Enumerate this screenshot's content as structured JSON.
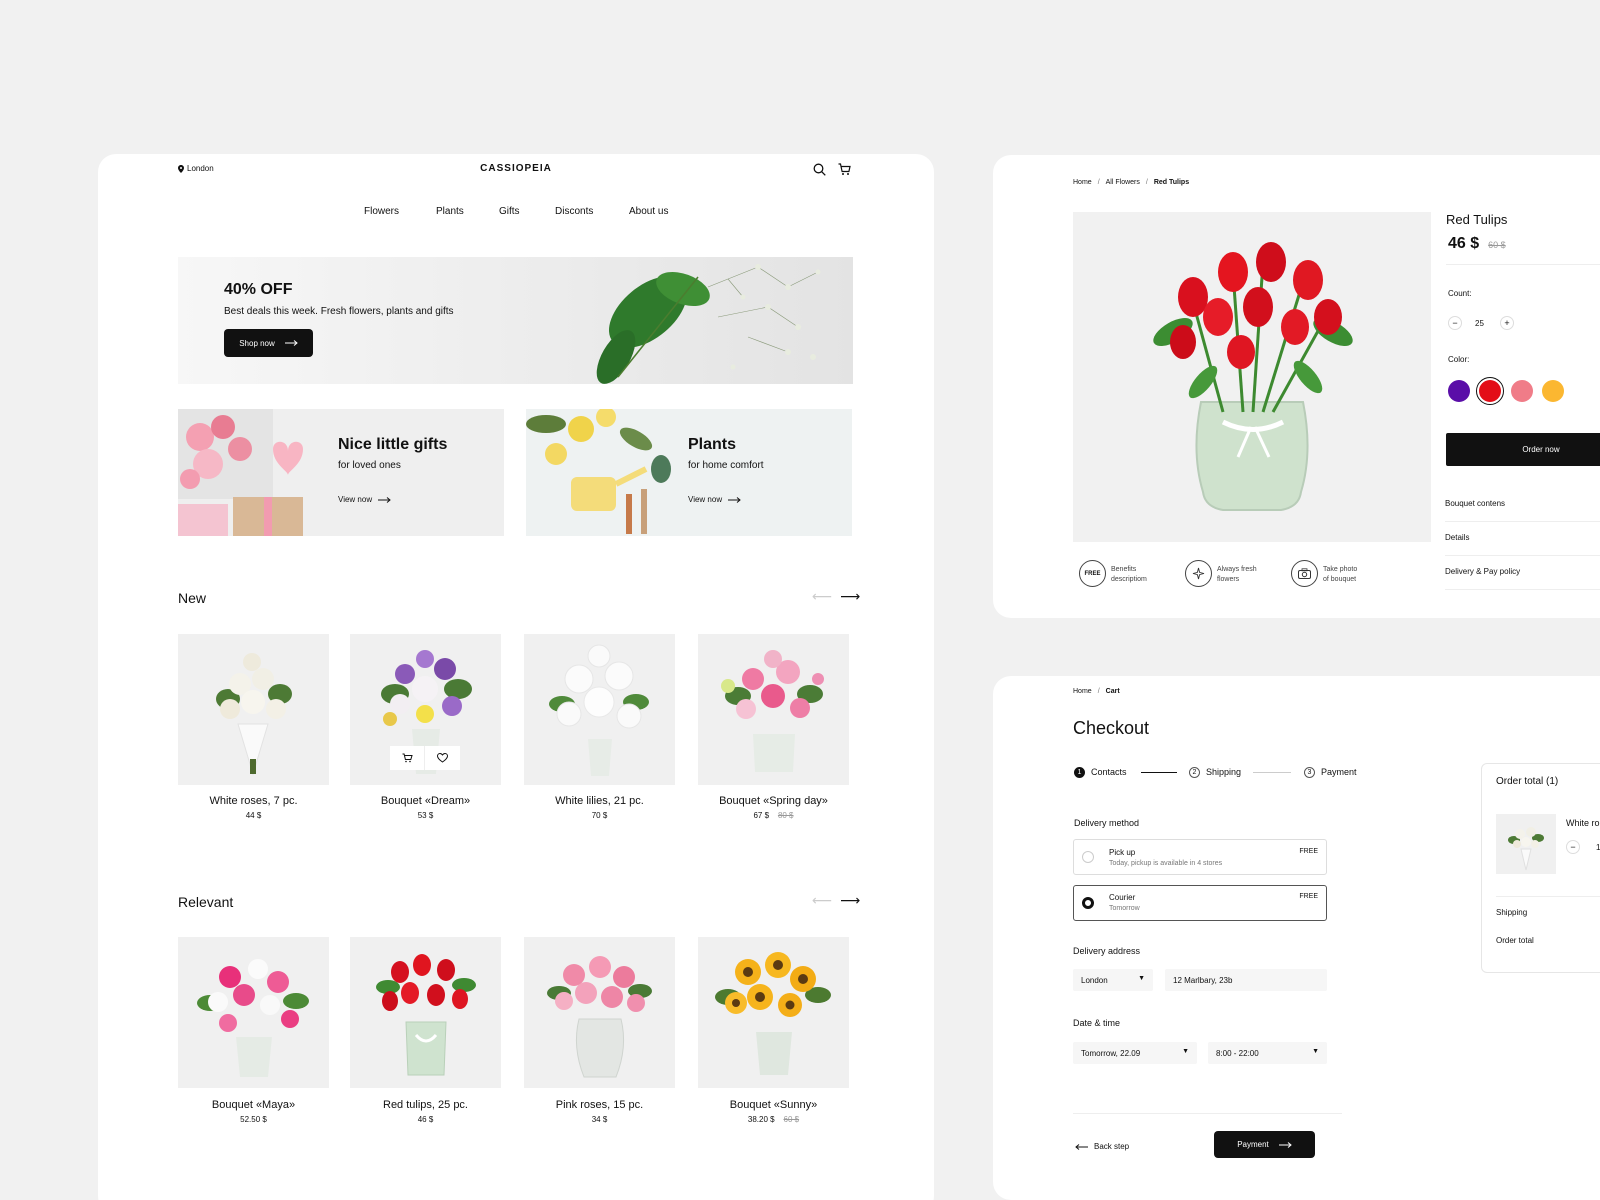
{
  "header": {
    "location": "London",
    "brand": "CASSIOPEIA",
    "nav": [
      "Flowers",
      "Plants",
      "Gifts",
      "Disconts",
      "About us"
    ]
  },
  "hero": {
    "title": "40% OFF",
    "subtitle": "Best deals this week. Fresh flowers, plants and gifts",
    "cta": "Shop now"
  },
  "promos": [
    {
      "title": "Nice little gifts",
      "subtitle": "for loved ones",
      "cta": "View now"
    },
    {
      "title": "Plants",
      "subtitle": "for home comfort",
      "cta": "View now"
    }
  ],
  "sections": {
    "new": {
      "title": "New",
      "products": [
        {
          "name": "White roses, 7 pc.",
          "price": "44 $",
          "old_price": ""
        },
        {
          "name": "Bouquet «Dream»",
          "price": "53 $",
          "old_price": ""
        },
        {
          "name": "White lilies, 21 pc.",
          "price": "70 $",
          "old_price": ""
        },
        {
          "name": "Bouquet «Spring day»",
          "price": "67 $",
          "old_price": "80 $"
        }
      ]
    },
    "relevant": {
      "title": "Relevant",
      "products": [
        {
          "name": "Bouquet «Maya»",
          "price": "52.50 $",
          "old_price": ""
        },
        {
          "name": "Red tulips, 25 pc.",
          "price": "46 $",
          "old_price": ""
        },
        {
          "name": "Pink roses, 15 pc.",
          "price": "34 $",
          "old_price": ""
        },
        {
          "name": "Bouquet «Sunny»",
          "price": "38.20 $",
          "old_price": "60 $"
        }
      ]
    }
  },
  "detail": {
    "breadcrumb": [
      "Home",
      "All Flowers",
      "Red Tulips"
    ],
    "breadcrumb_sep": "/",
    "title": "Red Tulips",
    "price": "46 $",
    "old_price": "60 $",
    "count_label": "Count:",
    "count": "25",
    "color_label": "Color:",
    "colors": [
      "#5a0ea8",
      "#e30d17",
      "#f07c88",
      "#fbb731"
    ],
    "order_button": "Order now",
    "accordion": [
      "Bouquet contens",
      "Details",
      "Delivery & Pay policy"
    ],
    "benefits": [
      {
        "icon": "free-badge-icon",
        "icon_text": "FREE",
        "line1": "Benefits",
        "line2": "descriptiom"
      },
      {
        "icon": "sparkle-icon",
        "icon_text": "",
        "line1": "Always fresh",
        "line2": "flowers"
      },
      {
        "icon": "camera-icon",
        "icon_text": "",
        "line1": "Take photo",
        "line2": "of bouquet"
      }
    ]
  },
  "checkout": {
    "breadcrumb": [
      "Home",
      "Cart"
    ],
    "title": "Checkout",
    "steps": [
      {
        "num": "1",
        "label": "Contacts"
      },
      {
        "num": "2",
        "label": "Shipping"
      },
      {
        "num": "3",
        "label": "Payment"
      }
    ],
    "delivery_label": "Delivery method",
    "methods": [
      {
        "title": "Pick up",
        "subtitle": "Today, pickup is available in 4 stores",
        "price": "FREE",
        "selected": false
      },
      {
        "title": "Courier",
        "subtitle": "Tomorrow",
        "price": "FREE",
        "selected": true
      }
    ],
    "address_label": "Delivery address",
    "city": "London",
    "address": "12 Marlbary, 23b",
    "datetime_label": "Date & time",
    "date": "Tomorrow, 22.09",
    "time": "8:00 - 22:00",
    "back": "Back step",
    "payment_button": "Payment",
    "order_total_title": "Order total (1)",
    "order_item_name": "White ro",
    "order_item_qty": "1",
    "shipping_label": "Shipping",
    "total_label": "Order total"
  }
}
